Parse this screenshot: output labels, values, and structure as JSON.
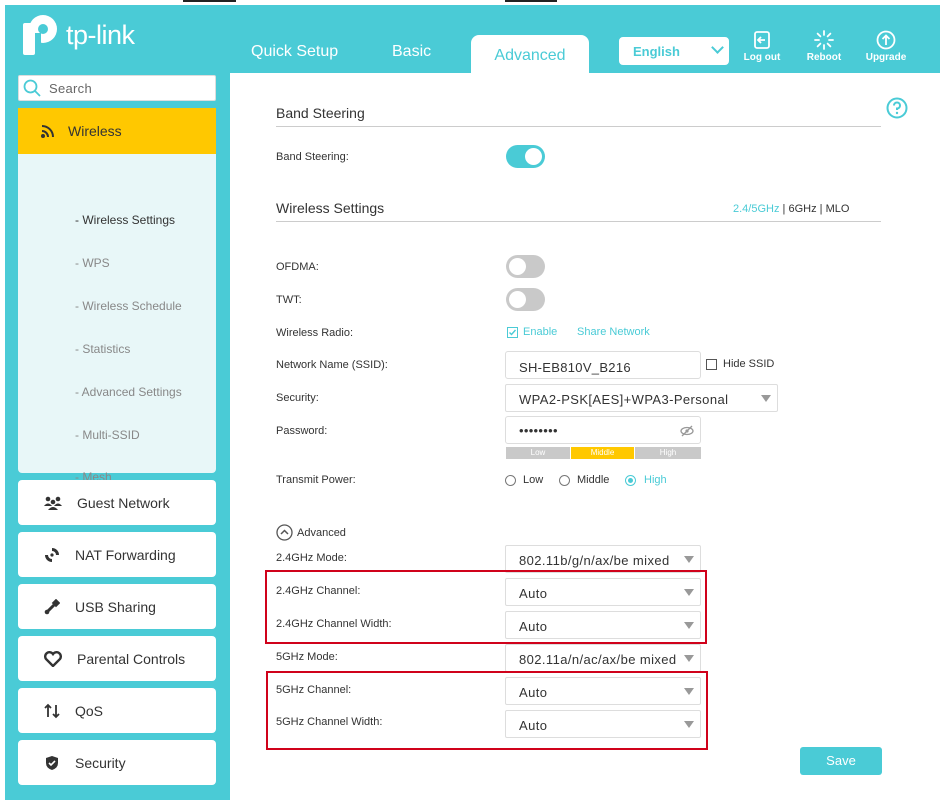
{
  "header": {
    "logo_text": "tp-link",
    "tabs": [
      {
        "label": "Quick Setup"
      },
      {
        "label": "Basic"
      },
      {
        "label": "Advanced"
      }
    ],
    "language": "English",
    "buttons": [
      {
        "label": "Log out",
        "icon": "logout-icon"
      },
      {
        "label": "Reboot",
        "icon": "reboot-icon"
      },
      {
        "label": "Upgrade",
        "icon": "upgrade-icon"
      }
    ]
  },
  "sidebar": {
    "search_placeholder": "Search",
    "wireless": {
      "label": "Wireless",
      "icon": "wireless-icon",
      "sub_items": [
        {
          "label": "- Wireless Settings"
        },
        {
          "label": "- WPS"
        },
        {
          "label": "- Wireless Schedule"
        },
        {
          "label": "- Statistics"
        },
        {
          "label": "- Advanced Settings"
        },
        {
          "label": "- Multi-SSID"
        },
        {
          "label": "- Mesh"
        }
      ]
    },
    "items": [
      {
        "label": "Guest Network",
        "icon": "guest-network-icon"
      },
      {
        "label": "NAT Forwarding",
        "icon": "nat-forwarding-icon"
      },
      {
        "label": "USB Sharing",
        "icon": "usb-icon"
      },
      {
        "label": "Parental Controls",
        "icon": "heart-icon"
      },
      {
        "label": "QoS",
        "icon": "qos-icon"
      },
      {
        "label": "Security",
        "icon": "shield-icon"
      }
    ]
  },
  "main": {
    "band_steering": {
      "title": "Band Steering",
      "label": "Band Steering:",
      "enabled": true
    },
    "wireless_settings": {
      "title": "Wireless Settings",
      "band_active": "2.4/5GHz",
      "band_sep1": "|",
      "band_6": "6GHz",
      "band_sep2": "|",
      "band_mlo": "MLO"
    },
    "ofdma": {
      "label": "OFDMA:",
      "enabled": false
    },
    "twt": {
      "label": "TWT:",
      "enabled": false
    },
    "wireless_radio": {
      "label": "Wireless Radio:",
      "enable_label": "Enable",
      "share_label": "Share Network",
      "enabled": true
    },
    "ssid": {
      "label": "Network Name (SSID):",
      "value": "SH-EB810V_B216",
      "hide_label": "Hide SSID"
    },
    "security": {
      "label": "Security:",
      "value": "WPA2-PSK[AES]+WPA3-Personal"
    },
    "password": {
      "label": "Password:",
      "value": "••••••••",
      "strength": [
        "Low",
        "Middle",
        "High"
      ],
      "strength_level": "Middle"
    },
    "transmit_power": {
      "label": "Transmit Power:",
      "options": [
        "Low",
        "Middle",
        "High"
      ],
      "selected": "High"
    },
    "advanced_toggle": "Advanced",
    "mode_24": {
      "label": "2.4GHz Mode:",
      "value": "802.11b/g/n/ax/be mixed"
    },
    "channel_24": {
      "label": "2.4GHz Channel:",
      "value": "Auto"
    },
    "width_24": {
      "label": "2.4GHz Channel Width:",
      "value": "Auto"
    },
    "mode_5": {
      "label": "5GHz Mode:",
      "value": "802.11a/n/ac/ax/be mixed"
    },
    "channel_5": {
      "label": "5GHz Channel:",
      "value": "Auto"
    },
    "width_5": {
      "label": "5GHz Channel Width:",
      "value": "Auto"
    },
    "save_label": "Save"
  },
  "colors": {
    "accent": "#4acbd6",
    "highlight": "#ffc800",
    "annotation": "#d0021b"
  }
}
